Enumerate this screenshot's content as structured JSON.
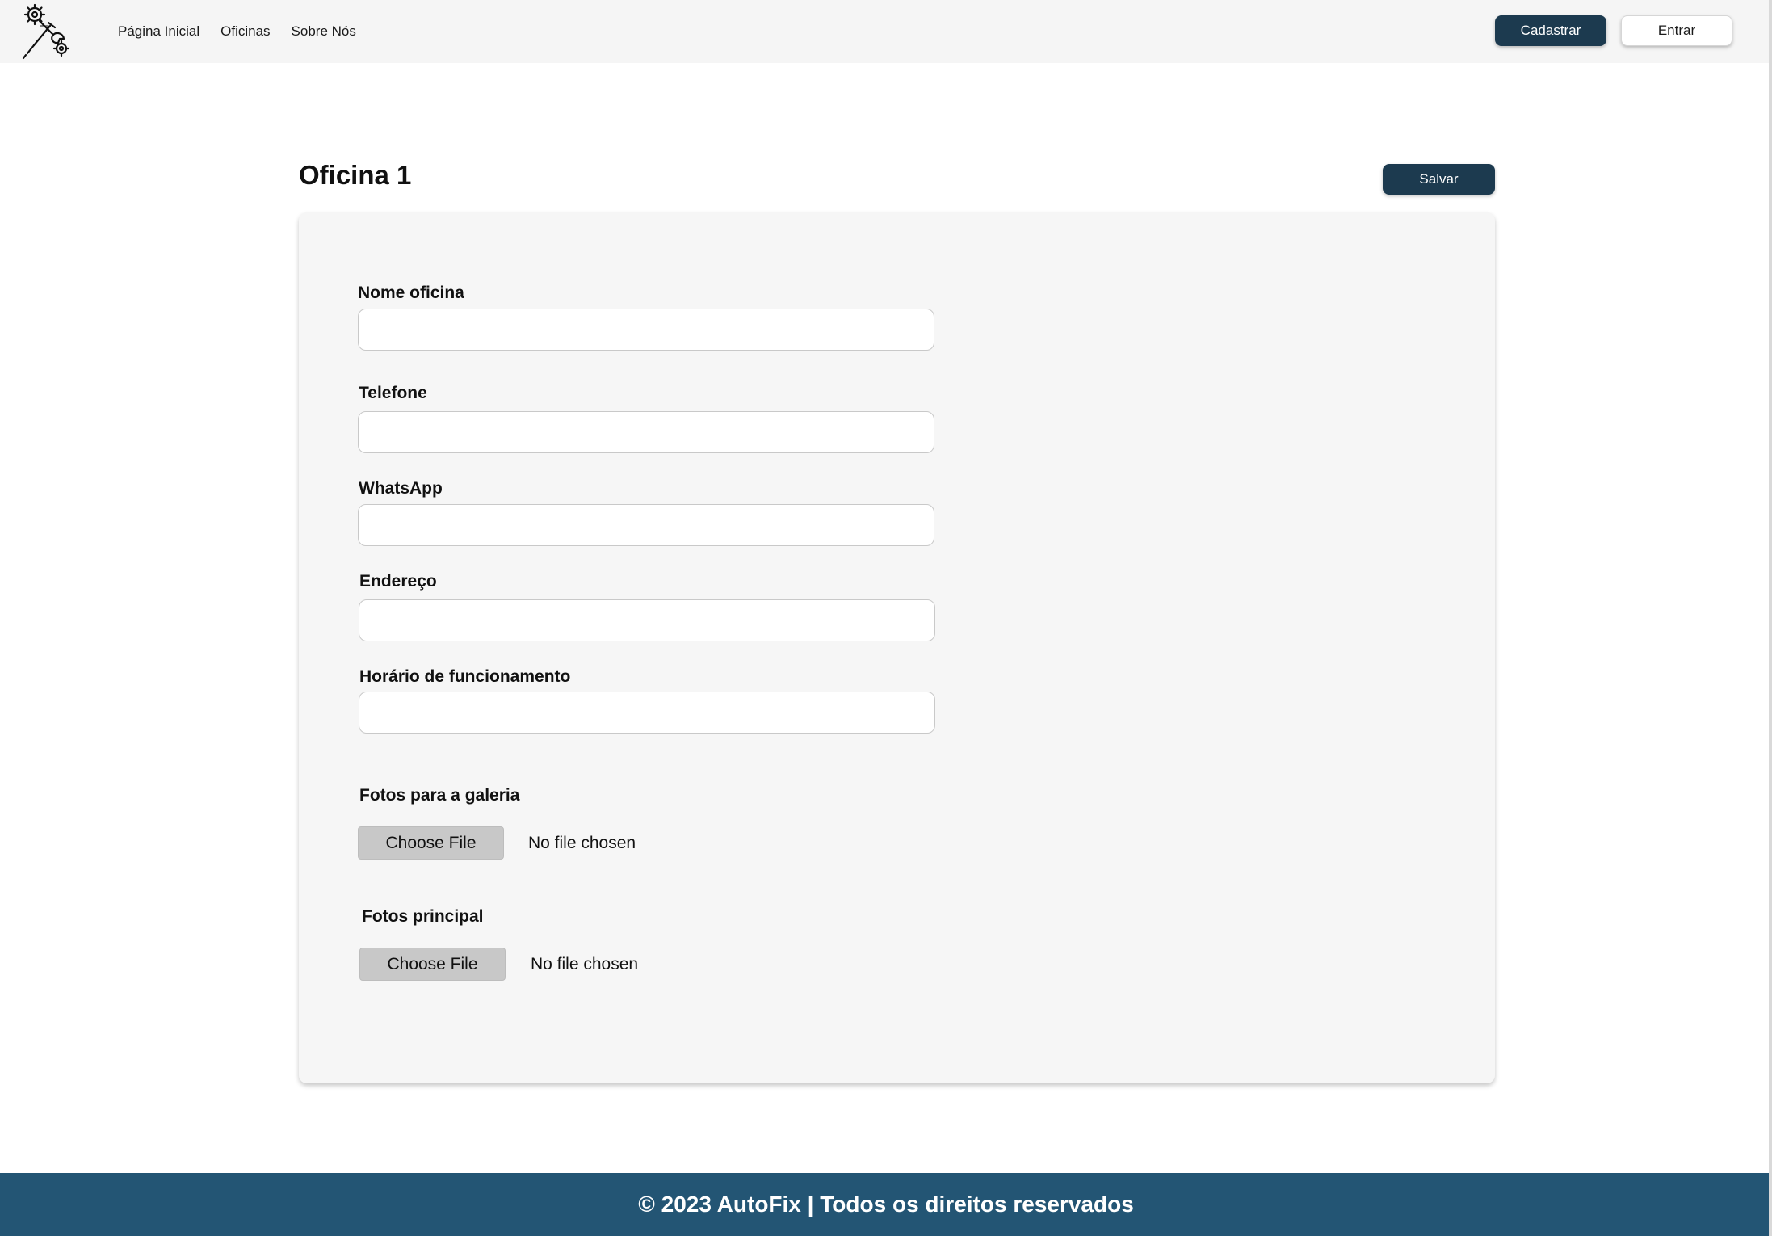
{
  "nav": {
    "links": [
      "Página Inicial",
      "Oficinas",
      "Sobre Nós"
    ],
    "register_label": "Cadastrar",
    "login_label": "Entrar"
  },
  "page": {
    "title": "Oficina 1",
    "save_label": "Salvar"
  },
  "form": {
    "fields": [
      {
        "label": "Nome oficina",
        "value": "",
        "placeholder": ""
      },
      {
        "label": "Telefone",
        "value": "",
        "placeholder": ""
      },
      {
        "label": "WhatsApp",
        "value": "",
        "placeholder": ""
      },
      {
        "label": "Endereço",
        "value": "",
        "placeholder": ""
      },
      {
        "label": "Horário de funcionamento",
        "value": "",
        "placeholder": ""
      }
    ],
    "gallery": {
      "label": "Fotos para a galeria",
      "button": "Choose File",
      "status": "No file chosen"
    },
    "main_photo": {
      "label": "Fotos principal",
      "button": "Choose File",
      "status": "No file chosen"
    }
  },
  "footer": {
    "text": "© 2023 AutoFix | Todos os direitos reservados"
  },
  "colors": {
    "nav_background": "#f5f5f5",
    "primary_button": "#1c3a4f",
    "card_background": "#f6f6f6",
    "footer_background": "#235574"
  },
  "icons": {
    "logo": "mechanic-tools-logo-icon"
  }
}
